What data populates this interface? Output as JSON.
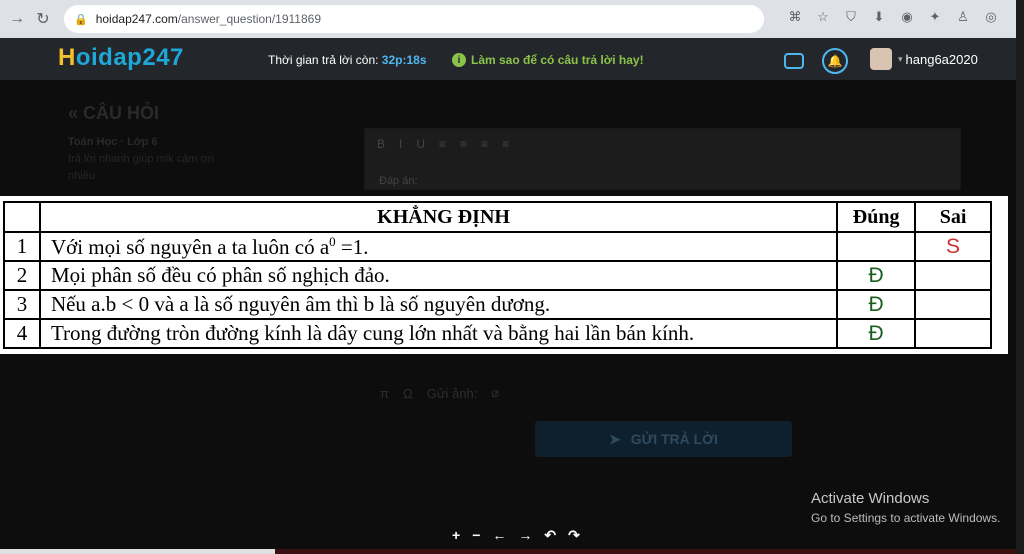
{
  "browser": {
    "url_host": "hoidap247.com",
    "url_path": "/answer_question/1911869"
  },
  "header": {
    "logo_initial": "H",
    "logo_rest": "oidap247",
    "timer_label": "Thời gian trả lời còn: ",
    "timer_value": "32p:18s",
    "tip_text": "Làm sao để có câu trả lời hay!",
    "username": "hang6a2020"
  },
  "question": {
    "back_title": "« CÂU HỎI",
    "subject": "Toán Học · Lớp 6",
    "text": "trả lời nhanh giúp mik cảm ơn nhiều"
  },
  "editor": {
    "toolbar": [
      "B",
      "I",
      "U",
      "≡",
      "≡",
      "≡",
      "≡"
    ],
    "placeholder": "Đáp án:"
  },
  "claims_table": {
    "headers": {
      "claim": "KHẲNG ĐỊNH",
      "true": "Đúng",
      "false": "Sai"
    },
    "rows": [
      {
        "no": "1",
        "claim_a": "Với mọi số nguyên a ta luôn có  a",
        "claim_sup": "0",
        "claim_b": " =1.",
        "true": "",
        "false": "S"
      },
      {
        "no": "2",
        "claim": "Mọi phân số đều có phân số nghịch đảo.",
        "true": "Đ",
        "false": ""
      },
      {
        "no": "3",
        "claim": "Nếu a.b < 0 và a là số nguyên âm thì b là số nguyên dương.",
        "true": "Đ",
        "false": ""
      },
      {
        "no": "4",
        "claim": "Trong đường tròn đường kính là dây cung lớn nhất và bằng hai lần bán kính.",
        "true": "Đ",
        "false": ""
      }
    ]
  },
  "insert_bar": {
    "pi": "π",
    "omega": "Ω",
    "attach": "Gửi ảnh:"
  },
  "submit": {
    "label": "GỬI TRẢ LỜI"
  },
  "activation": {
    "title": "Activate Windows",
    "subtitle": "Go to Settings to activate Windows."
  },
  "viewer_controls": [
    "+",
    "−",
    "←",
    "→",
    "↶",
    "↷"
  ]
}
